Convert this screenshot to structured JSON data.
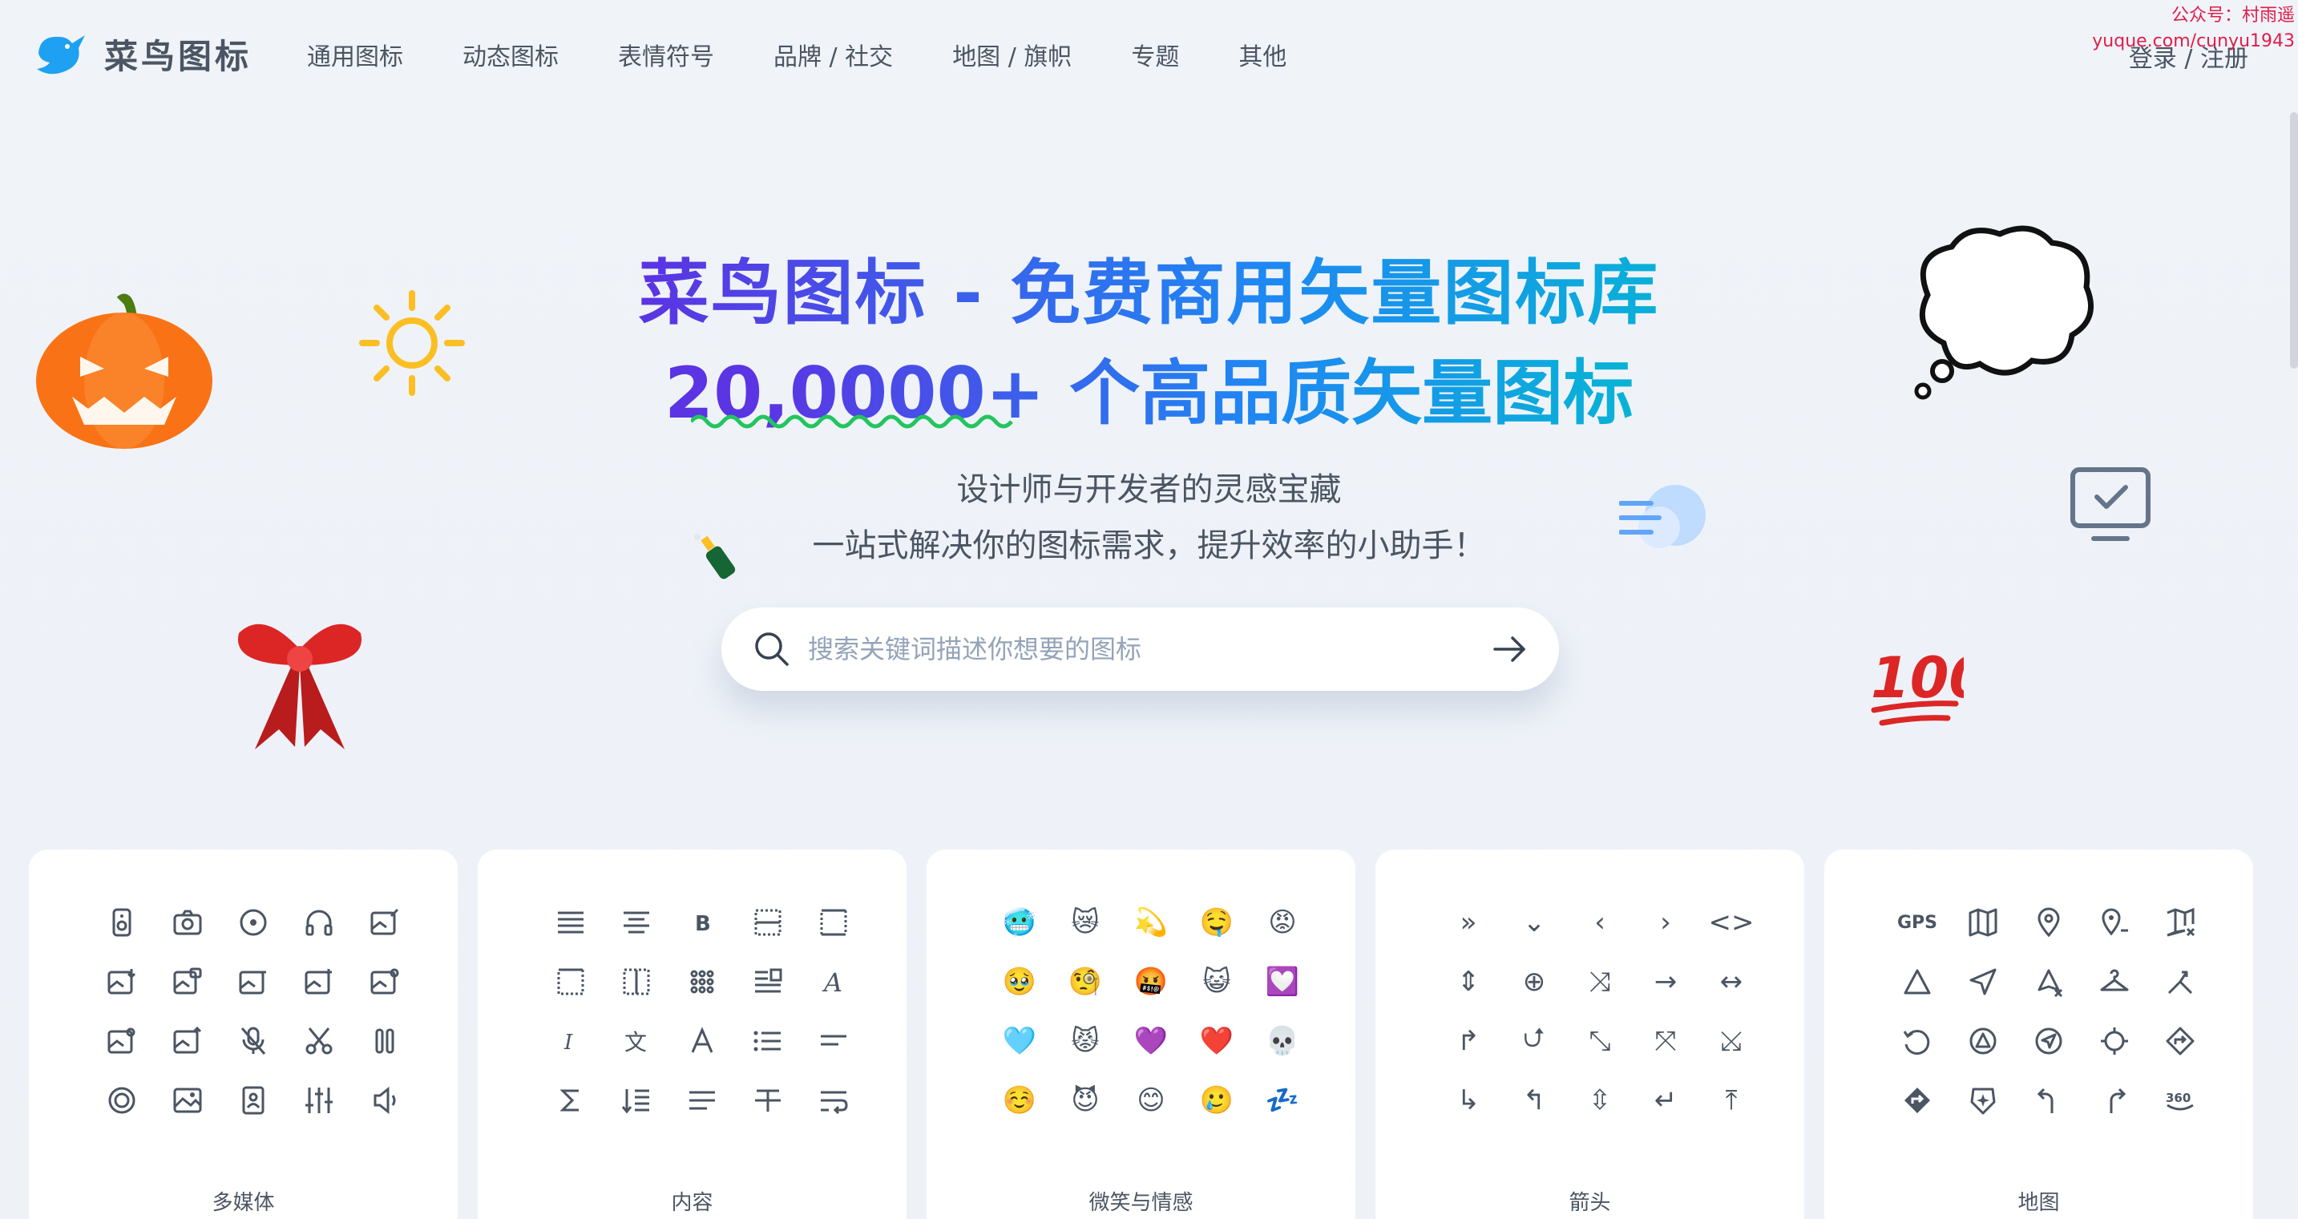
{
  "watermark": {
    "line1": "公众号：村雨遥",
    "line2": "yuque.com/cunyu1943"
  },
  "logo": {
    "text": "菜鸟图标"
  },
  "nav": {
    "items": [
      "通用图标",
      "动态图标",
      "表情符号",
      "品牌 / 社交",
      "地图 / 旗帜",
      "专题",
      "其他"
    ],
    "login": "登录 / 注册"
  },
  "hero": {
    "title": "菜鸟图标 - 免费商用矢量图标库",
    "subtitle": "20,0000+ 个高品质矢量图标",
    "tagline1": "设计师与开发者的灵感宝藏",
    "tagline2": "一站式解决你的图标需求，提升效率的小助手！"
  },
  "search": {
    "placeholder": "搜索关键词描述你想要的图标"
  },
  "decorations": [
    "pumpkin-emoji",
    "sun-icon",
    "bow-emoji",
    "champagne-emoji",
    "thought-bubble",
    "wind-emoji",
    "monitor-check-icon",
    "hundred-emoji"
  ],
  "cards": [
    {
      "label": "多媒体"
    },
    {
      "label": "内容"
    },
    {
      "label": "微笑与情感",
      "emojis": [
        "🥶",
        "😿",
        "💫",
        "🤤",
        "😡",
        "🥹",
        "🧐",
        "🤬",
        "😺",
        "💟",
        "🩵",
        "😾",
        "💜",
        "❤️",
        "💀",
        "☺️",
        "😈",
        "😊",
        "🥲",
        "💤"
      ]
    },
    {
      "label": "箭头",
      "glyphs": [
        "»",
        "⌄",
        "‹",
        "›",
        "<>",
        "⇕",
        "⊕",
        "⤨",
        "→",
        "↔",
        "↱",
        "⮍",
        "⤡",
        "⤧",
        "⤩",
        "↳",
        "↰",
        "⇳",
        "↵",
        "⤒"
      ]
    },
    {
      "label": "地图",
      "gps": "GPS",
      "three_sixty": "360"
    }
  ],
  "colors": {
    "accent_purple": "#5b34e3",
    "accent_blue": "#1e88f3",
    "accent_cyan": "#06b6d4"
  }
}
